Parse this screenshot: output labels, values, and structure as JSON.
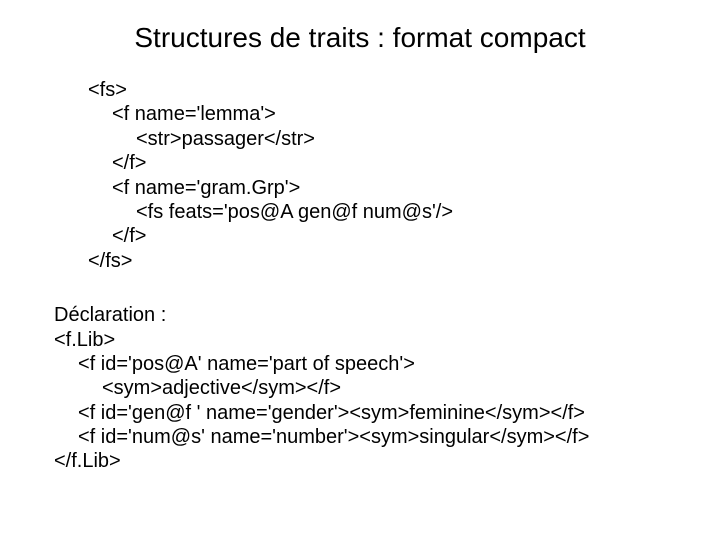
{
  "title": "Structures de traits : format compact",
  "code1": {
    "l1": "<fs>",
    "l2": "<f name='lemma'>",
    "l3": "<str>passager</str>",
    "l4": "</f>",
    "l5": "<f name='gram.Grp'>",
    "l6": "<fs feats='pos@A gen@f num@s'/>",
    "l7": "</f>",
    "l8": "</fs>"
  },
  "decl": {
    "heading": "Déclaration :",
    "l1": "<f.Lib>",
    "l2": "<f id='pos@A' name='part of speech'>",
    "l3": "<sym>adjective</sym></f>",
    "l4": "<f id='gen@f ' name='gender'><sym>feminine</sym></f>",
    "l5": "<f id='num@s' name='number'><sym>singular</sym></f>",
    "l6": "</f.Lib>"
  }
}
